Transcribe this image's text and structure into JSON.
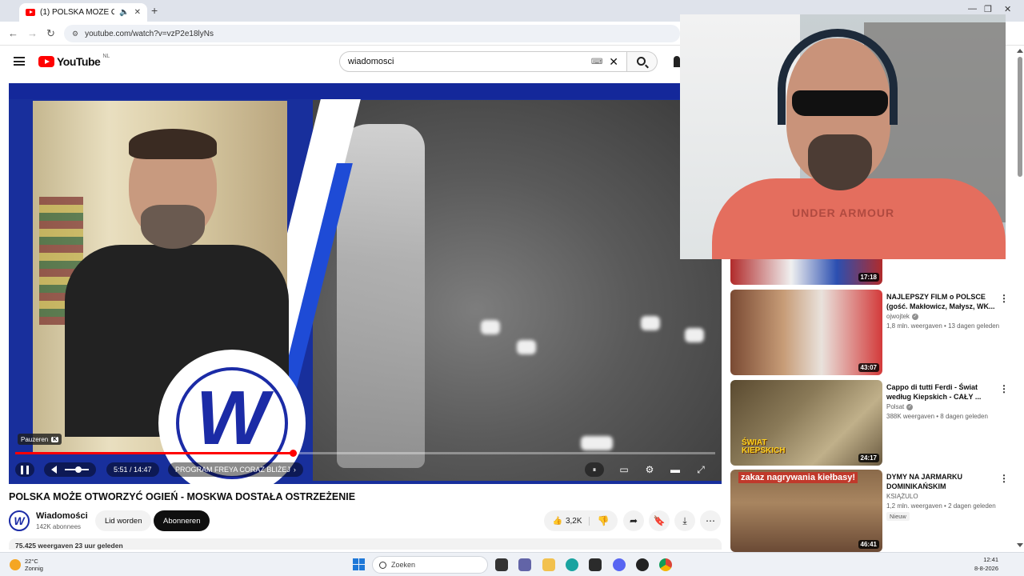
{
  "browser": {
    "tab_title": "(1) POLSKA MOŻE OTWORZ",
    "url": "youtube.com/watch?v=vzP2e18lyNs"
  },
  "youtube": {
    "logo_text": "YouTube",
    "region": "NL",
    "search_query": "wiadomosci"
  },
  "player": {
    "tooltip_label": "Pauzeren",
    "tooltip_key": "K",
    "time_display": "5:51 / 14:47",
    "chapter_label": "PROGRAM FREYA CORAZ BLIŻEJ",
    "chapter_chevron": "›",
    "progress_fraction": 0.396,
    "logo_letter": "W"
  },
  "webcam": {
    "shirt_text": "UNDER ARMOUR"
  },
  "video": {
    "title": "POLSKA MOŻE OTWORZYĆ OGIEŃ - MOSKWA DOSTAŁA OSTRZEŻENIE",
    "channel_name": "Wiadomości",
    "channel_subs": "142K abonnees",
    "join_label": "Lid worden",
    "subscribe_label": "Abonneren",
    "like_count": "3,2K",
    "description_peek": "75.425 weergaven  23 uur geleden"
  },
  "related": [
    {
      "duration": "17:18"
    },
    {
      "title": "NAJLEPSZY FILM o POLSCE (gość. Makłowicz, Małysz, WK...",
      "channel": "ojwojtek",
      "meta": "1,8 mln. weergaven • 13 dagen geleden",
      "duration": "43:07"
    },
    {
      "title": "Cappo di tutti Ferdi - Świat według Kiepskich - CAŁY ...",
      "channel": "Polsat",
      "meta": "388K weergaven • 8 dagen geleden",
      "duration": "24:17",
      "thumb_text": "ŚWIAT KIEPSKICH"
    },
    {
      "title": "DYMY NA JARMARKU DOMINIKAŃSKIM",
      "channel": "KSIĄŻULO",
      "meta": "1,2 mln. weergaven • 2 dagen geleden",
      "badge": "Nieuw",
      "duration": "46:41",
      "thumb_text": "zakaz nagrywania kiełbasy!"
    }
  ],
  "taskbar": {
    "weather_temp": "22°C",
    "weather_desc": "Zonnig",
    "search_placeholder": "Zoeken",
    "time": "12:41",
    "date": "8-8-2026"
  }
}
